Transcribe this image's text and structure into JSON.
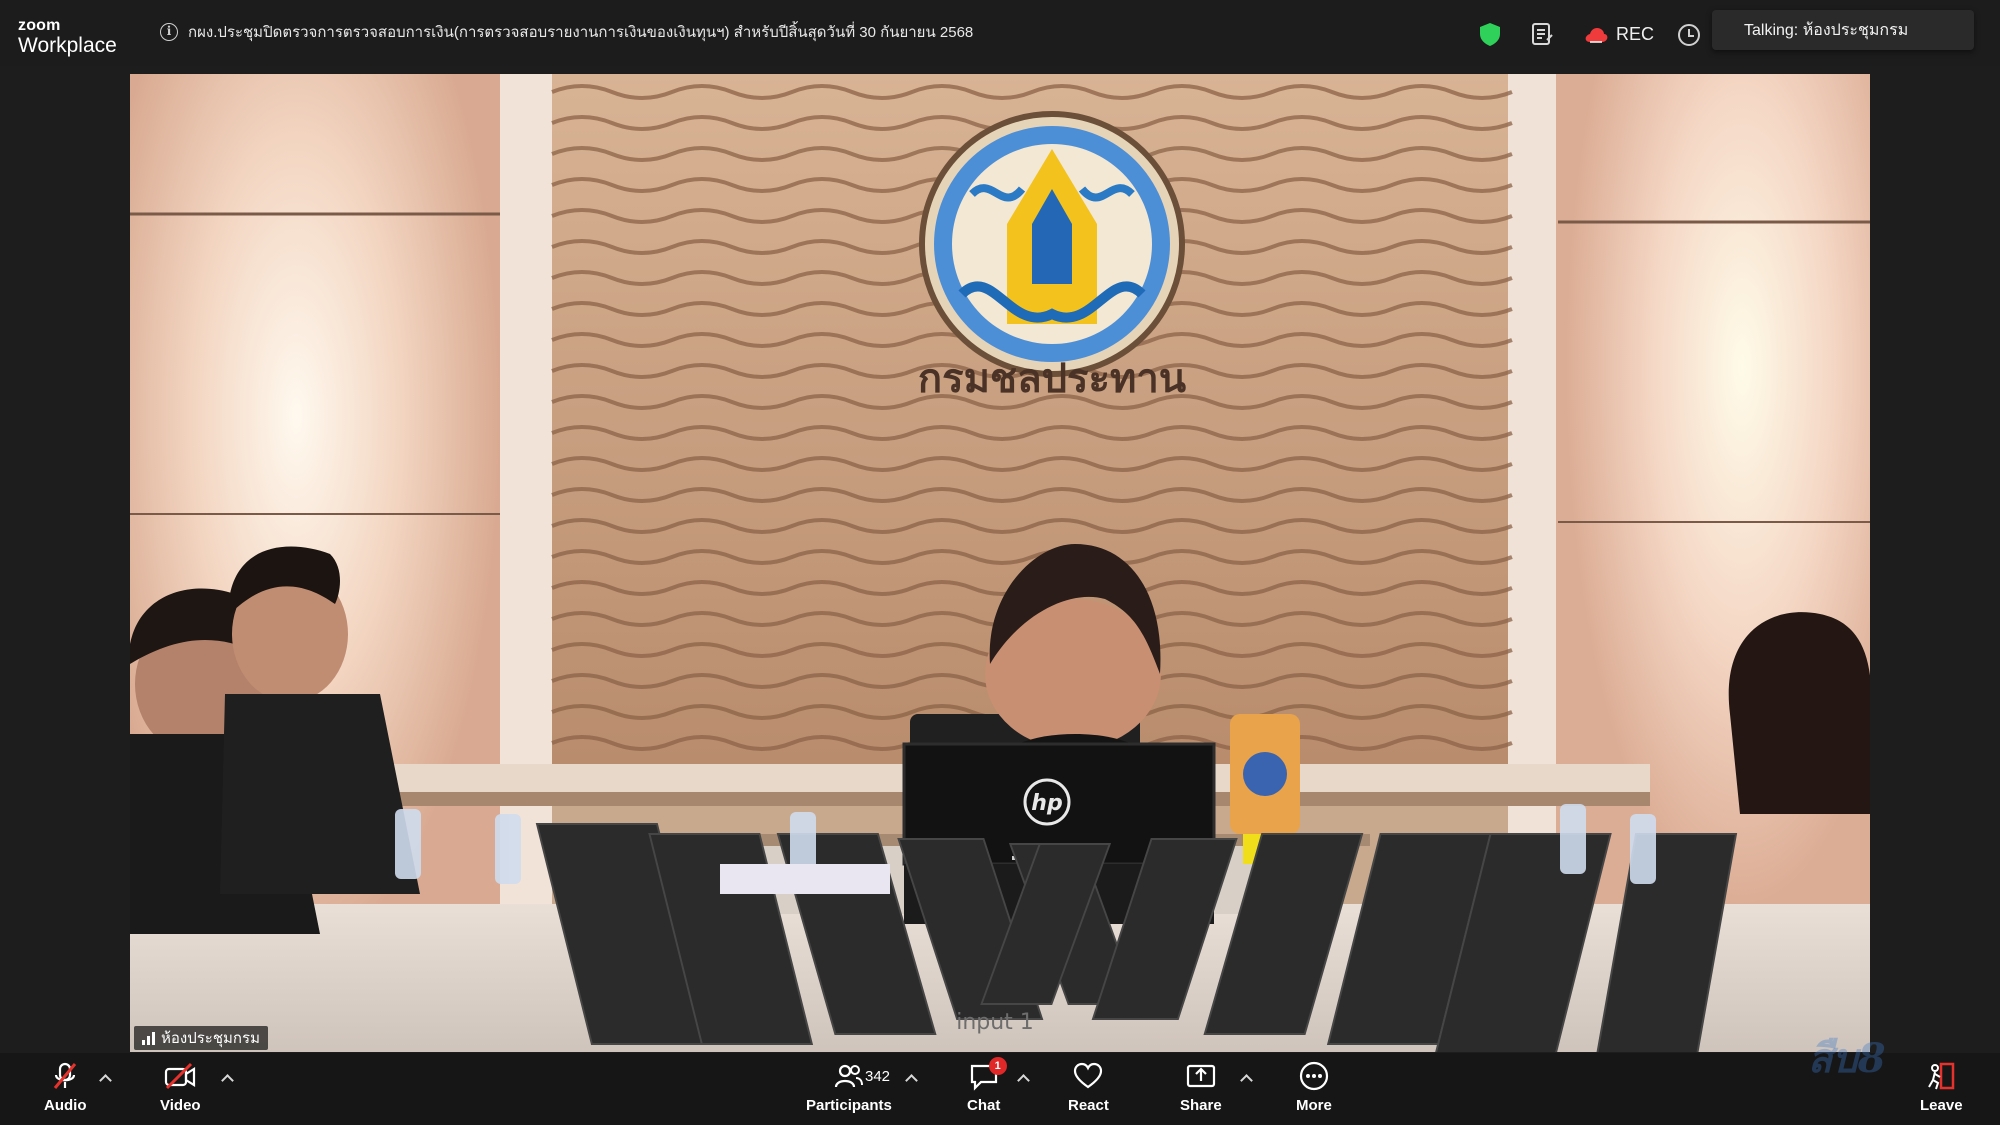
{
  "app": {
    "brand_small": "zoom",
    "brand_large": "Workplace"
  },
  "meeting": {
    "title": "กผง.ประชุมปิดตรวจการตรวจสอบการเงิน(การตรวจสอบรายงานการเงินของเงินทุนฯ) สำหรับปีสิ้นสุดวันที่ 30 กันยายน 2568"
  },
  "top_controls": {
    "rec_label": "REC",
    "talking_label": "Talking: ห้องประชุมกรม"
  },
  "video": {
    "participant_name": "ห้องประชุมกรม",
    "overlay_text": "input 1",
    "wall_emblem_text": "กรมชลประทาน",
    "laptop_logo": "hp"
  },
  "toolbar": {
    "audio_label": "Audio",
    "video_label": "Video",
    "participants_label": "Participants",
    "participants_count": "342",
    "chat_label": "Chat",
    "chat_badge": "1",
    "react_label": "React",
    "share_label": "Share",
    "more_label": "More",
    "leave_label": "Leave"
  },
  "watermark": "สืบ8",
  "icons": {
    "info": "info-icon",
    "shield": "shield-icon",
    "notes": "notes-icon",
    "cloud": "cloud-record-icon",
    "clock": "clock-icon",
    "mic_muted": "microphone-muted-icon",
    "video_off": "video-off-icon",
    "participants": "participants-icon",
    "chat": "chat-icon",
    "react": "heart-icon",
    "share": "share-screen-icon",
    "more": "more-icon",
    "leave": "leave-icon"
  },
  "colors": {
    "shield_green": "#2fd15a",
    "rec_red": "#ef3b3b",
    "muted_red": "#e5322d",
    "badge_red": "#e02828",
    "leave_red": "#e5322d"
  }
}
